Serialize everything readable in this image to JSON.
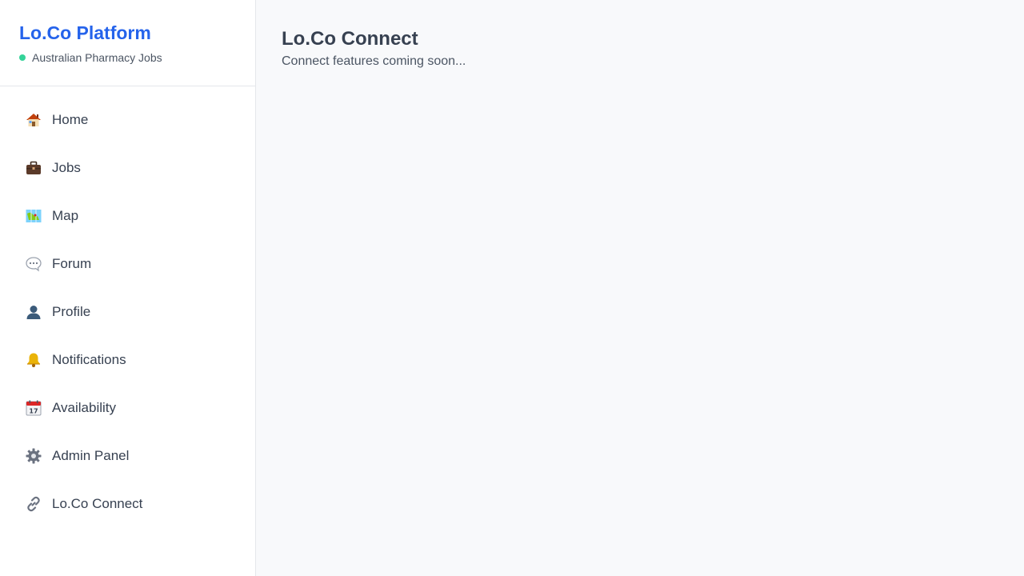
{
  "sidebar": {
    "brand_title": "Lo.Co Platform",
    "brand_subtitle": "Australian Pharmacy Jobs",
    "status_color": "#34d399",
    "items": [
      {
        "label": "Home",
        "icon": "house-icon"
      },
      {
        "label": "Jobs",
        "icon": "briefcase-icon"
      },
      {
        "label": "Map",
        "icon": "map-icon"
      },
      {
        "label": "Forum",
        "icon": "speech-bubble-icon"
      },
      {
        "label": "Profile",
        "icon": "user-icon"
      },
      {
        "label": "Notifications",
        "icon": "bell-icon"
      },
      {
        "label": "Availability",
        "icon": "calendar-icon"
      },
      {
        "label": "Admin Panel",
        "icon": "gear-icon"
      },
      {
        "label": "Lo.Co Connect",
        "icon": "link-icon"
      }
    ]
  },
  "main": {
    "title": "Lo.Co Connect",
    "subtitle": "Connect features coming soon..."
  },
  "colors": {
    "brand": "#2563eb",
    "main_bg": "#f8f9fb",
    "sidebar_bg": "#ffffff"
  }
}
